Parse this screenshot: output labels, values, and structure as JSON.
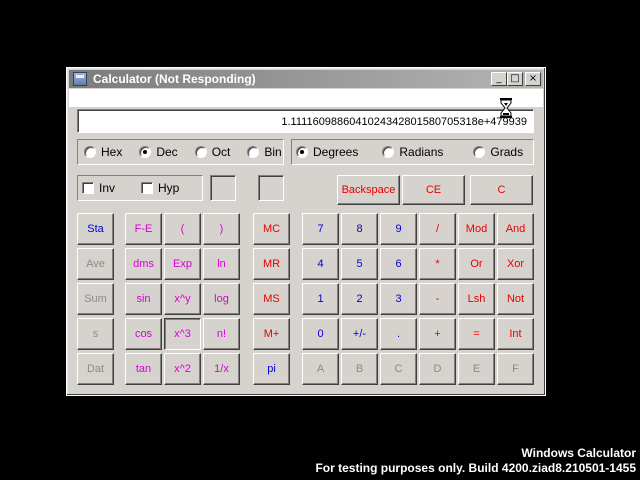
{
  "window": {
    "title": "Calculator (Not Responding)",
    "buttons": {
      "minimize": "_",
      "maximize": "□",
      "close": "×"
    }
  },
  "display": {
    "value": "1.1111609886041024342801580705318e+479939"
  },
  "number_system": {
    "options": [
      "Hex",
      "Dec",
      "Oct",
      "Bin"
    ],
    "selected": "Dec"
  },
  "angle_mode": {
    "options": [
      "Degrees",
      "Radians",
      "Grads"
    ],
    "selected": "Degrees"
  },
  "toggles": {
    "inv": "Inv",
    "hyp": "Hyp"
  },
  "clear_buttons": {
    "backspace": "Backspace",
    "ce": "CE",
    "c": "C"
  },
  "stat_buttons": [
    "Sta",
    "Ave",
    "Sum",
    "s",
    "Dat"
  ],
  "sci_buttons": [
    [
      "F-E",
      "(",
      ")"
    ],
    [
      "dms",
      "Exp",
      "ln"
    ],
    [
      "sin",
      "x^y",
      "log"
    ],
    [
      "cos",
      "x^3",
      "n!"
    ],
    [
      "tan",
      "x^2",
      "1/x"
    ]
  ],
  "memory_buttons": [
    "MC",
    "MR",
    "MS",
    "M+",
    "pi"
  ],
  "keypad": [
    [
      "7",
      "8",
      "9",
      "/",
      "Mod",
      "And"
    ],
    [
      "4",
      "5",
      "6",
      "*",
      "Or",
      "Xor"
    ],
    [
      "1",
      "2",
      "3",
      "-",
      "Lsh",
      "Not"
    ],
    [
      "0",
      "+/-",
      ".",
      "+",
      "=",
      "Int"
    ],
    [
      "A",
      "B",
      "C",
      "D",
      "E",
      "F"
    ]
  ],
  "footer": {
    "line1": "Windows Calculator",
    "line2": "For testing purposes only. Build 4200.ziad8.210501-1455"
  },
  "colors": {
    "red": "#e80000",
    "magenta": "#d600d6",
    "blue": "#0000d0",
    "disabled": "#8a8a8a",
    "face": "#d6d3ce"
  }
}
